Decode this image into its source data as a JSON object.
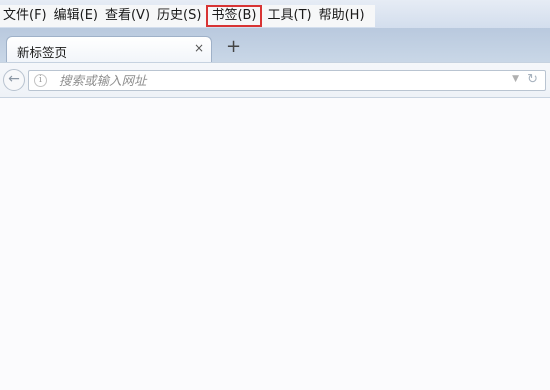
{
  "menubar": {
    "items": [
      {
        "label": "文件(F)"
      },
      {
        "label": "编辑(E)"
      },
      {
        "label": "查看(V)"
      },
      {
        "label": "历史(S)"
      },
      {
        "label": "书签(B)"
      },
      {
        "label": "工具(T)"
      },
      {
        "label": "帮助(H)"
      }
    ],
    "highlight_color": "#d83434"
  },
  "tabs": [
    {
      "title": "新标签页",
      "close_glyph": "×"
    }
  ],
  "new_tab_glyph": "+",
  "navbar": {
    "back_glyph": "←",
    "url_placeholder": "搜索或输入网址",
    "url_value": "",
    "dropdown_glyph": "▼",
    "reload_glyph": "↻",
    "info_glyph": "i"
  },
  "icons": [
    "back-arrow-icon",
    "info-icon",
    "dropdown-arrow-icon",
    "reload-icon",
    "close-icon",
    "plus-icon"
  ]
}
